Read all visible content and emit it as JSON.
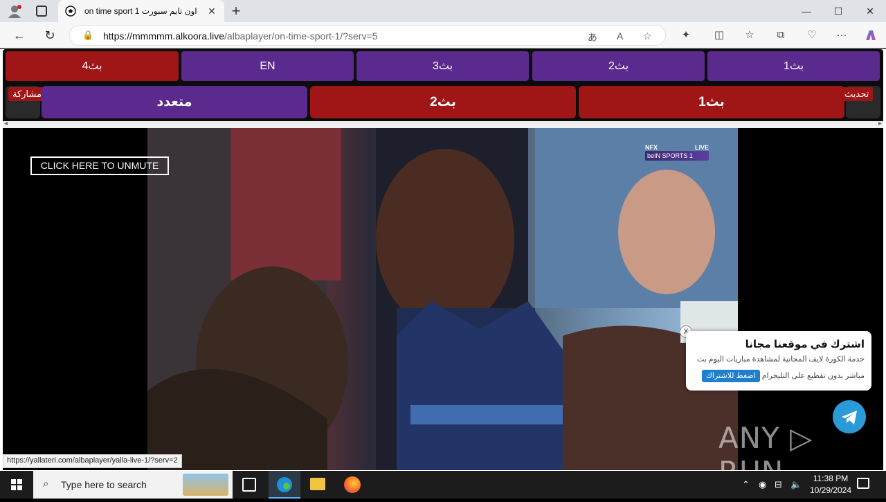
{
  "browser": {
    "tab_title": "on time sport 1 اون تايم سبورت",
    "tab_close": "✕",
    "new_tab": "+",
    "url_host": "https://mmmmm.alkoora.live",
    "url_path": "/albaplayer/on-time-sport-1/?serv=5",
    "window_controls": [
      "—",
      "☐",
      "✕"
    ]
  },
  "player": {
    "server_row": [
      "بث4",
      "EN",
      "بث3",
      "بث2",
      "بث1"
    ],
    "big_row": [
      "متعدد",
      "بث2",
      "بث1"
    ],
    "share_label": "مشاركة",
    "refresh_label": "تحديث",
    "unmute_label": "CLICK HERE TO UNMUTE",
    "channel_logo": "beIN SPORTS 1",
    "channel_top_left": "NFX",
    "channel_live": "LIVE"
  },
  "popup": {
    "close": "X",
    "title": "اشترك في موقعنا مجانا",
    "text1": "خدمة الكورة لايف المجانية لمشاهدة مباريات اليوم بث",
    "text2": "مباشر بدون تقطيع على التليجرام",
    "button": "اضغط للاشتراك"
  },
  "watermark": "ANY ▷ RUN",
  "status_url": "https://yallateri.com/albaplayer/yalla-live-1/?serv=2",
  "taskbar": {
    "search_placeholder": "Type here to search",
    "time": "11:38 PM",
    "date": "10/29/2024"
  },
  "colors": {
    "purple": "#5b2a8e",
    "red": "#a01616",
    "telegram": "#2a9bd8"
  }
}
